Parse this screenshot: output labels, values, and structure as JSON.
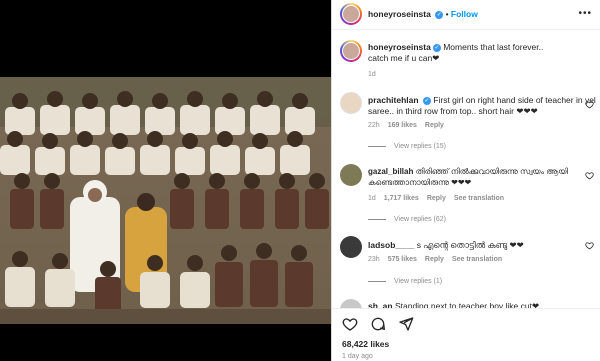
{
  "post": {
    "username": "honeyroseinsta",
    "follow_label": "Follow",
    "caption_line1": "Moments that last forever..",
    "caption_line2": "catch me if u can❤",
    "caption_age": "1d",
    "likes": "68,422 likes",
    "posted": "1 day ago"
  },
  "comments": [
    {
      "username": "prachitehlan",
      "text_line1": "First girl on right hand side of teacher in yello",
      "text_line2": "saree.. in third row from top.. short hair ❤❤❤",
      "age": "22h",
      "likes": "169 likes",
      "reply": "Reply",
      "view_replies": "View replies (15)"
    },
    {
      "username": "gazal_billah",
      "text_line1": "തിരിഞ്ഞ് നിൽക്കുവായിരുന്നു സ്വയം ആയി",
      "text_line2": "കണ്ടെത്താനായിരുന്നു ❤❤❤",
      "age": "1d",
      "likes": "1,717 likes",
      "reply": "Reply",
      "see_translation": "See translation",
      "view_replies": "View replies (62)"
    },
    {
      "username": "ladsob____",
      "text_line1": "s എന്റെ തൊട്ടിൽ കണ്ടു ❤❤",
      "age": "23h",
      "likes": "575 likes",
      "reply": "Reply",
      "see_translation": "See translation",
      "view_replies": "View replies (1)"
    },
    {
      "username": "sh_an",
      "text_line1": "Standing next to teacher boy like cut❤"
    }
  ],
  "colors": {
    "accent": "#0095f6",
    "verified": "#3897f0",
    "text": "#262626",
    "muted": "#8e8e8e"
  },
  "icons": [
    "more-icon",
    "heart-icon",
    "comment-icon",
    "share-icon",
    "verified-icon"
  ]
}
